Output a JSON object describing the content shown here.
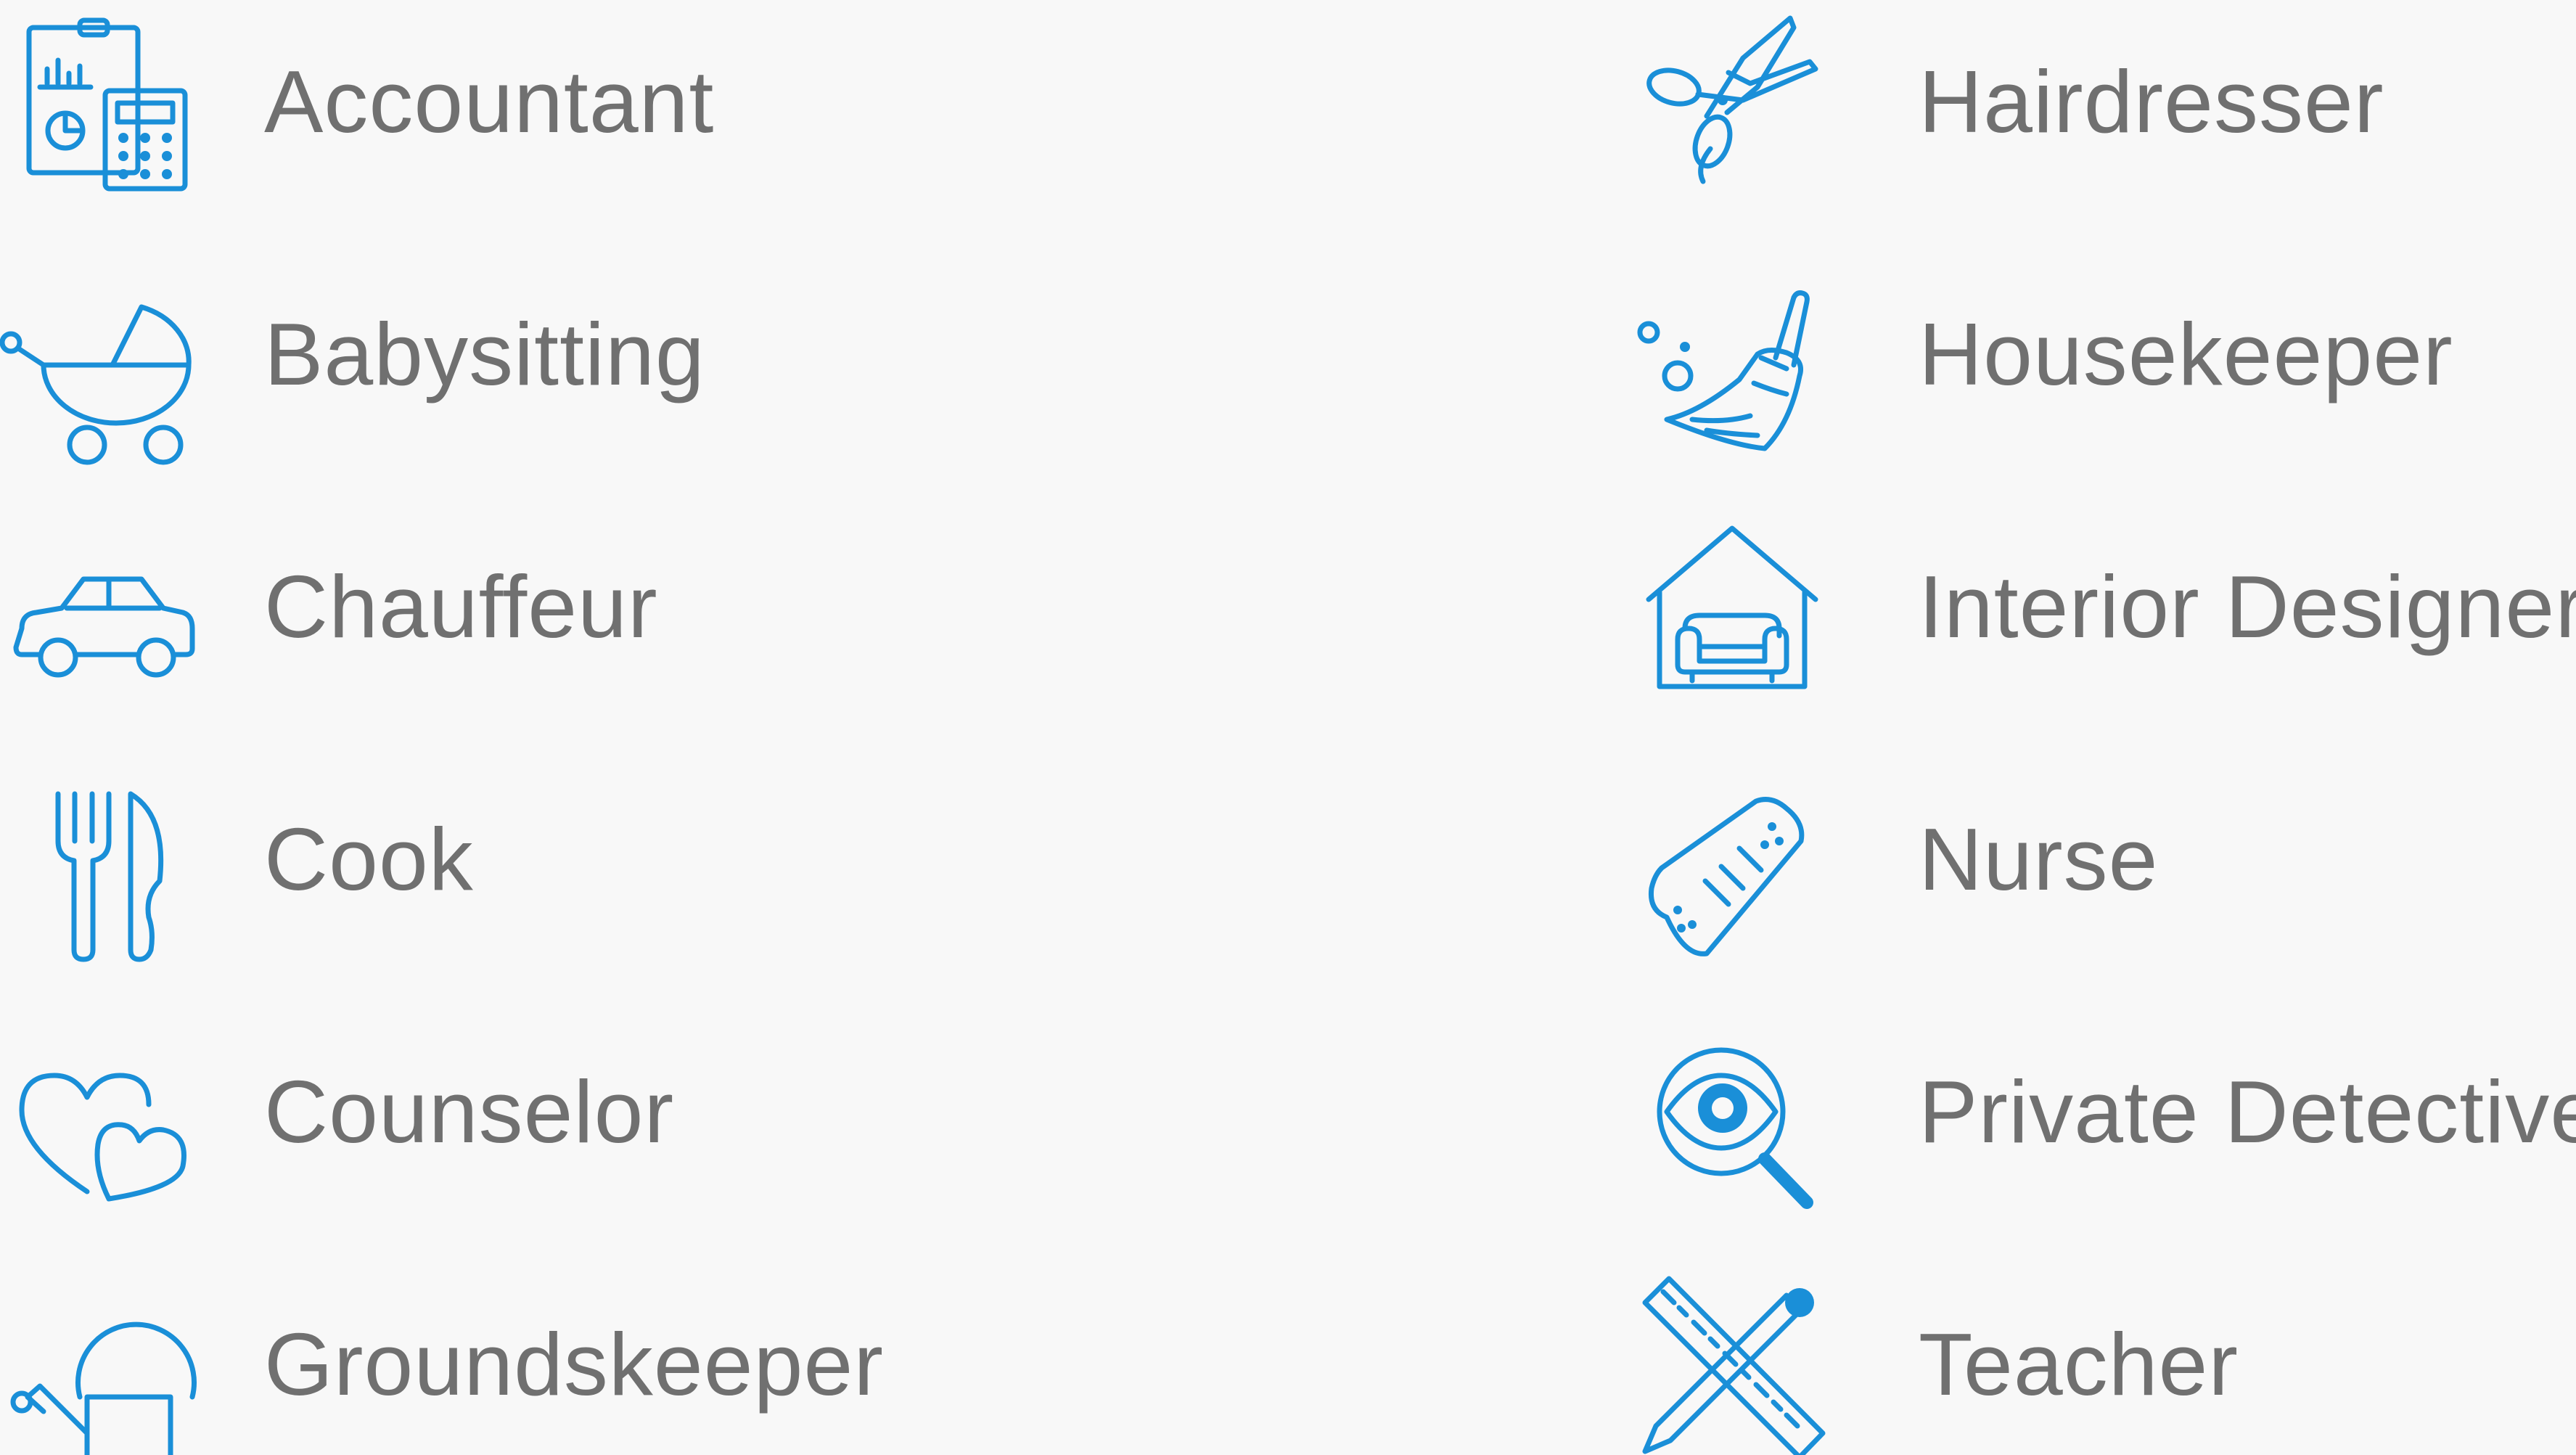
{
  "colors": {
    "background": "#f8f8f8",
    "icon_blue": "#1a8fd8",
    "label_gray": "#707070"
  },
  "services": {
    "left": [
      {
        "label": "Accountant",
        "icon": "accountant-icon"
      },
      {
        "label": "Babysitting",
        "icon": "baby-stroller-icon"
      },
      {
        "label": "Chauffeur",
        "icon": "car-icon"
      },
      {
        "label": "Cook",
        "icon": "fork-knife-icon"
      },
      {
        "label": "Counselor",
        "icon": "hearts-icon"
      },
      {
        "label": "Groundskeeper",
        "icon": "watering-can-icon"
      }
    ],
    "right": [
      {
        "label": "Hairdresser",
        "icon": "scissors-icon"
      },
      {
        "label": "Housekeeper",
        "icon": "broom-icon"
      },
      {
        "label": "Interior Designer",
        "icon": "house-sofa-icon"
      },
      {
        "label": "Nurse",
        "icon": "bandage-icon"
      },
      {
        "label": "Private Detective",
        "icon": "magnifier-eye-icon"
      },
      {
        "label": "Teacher",
        "icon": "pencil-ruler-icon"
      }
    ]
  }
}
